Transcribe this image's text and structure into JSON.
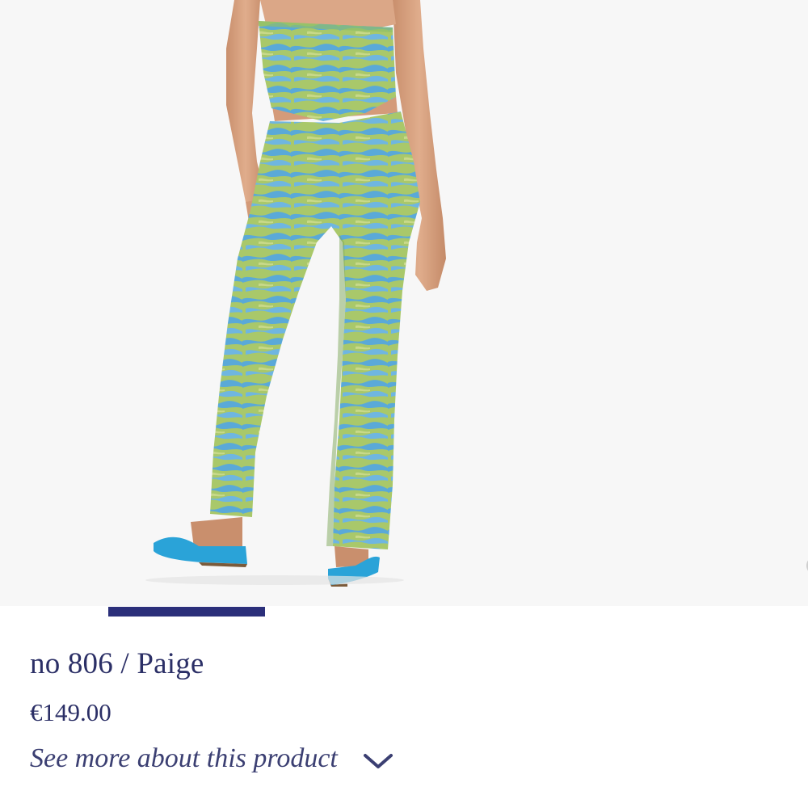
{
  "product": {
    "title": "no 806 / Paige",
    "price": "€149.00",
    "see_more_label": "See more about this product"
  },
  "gallery": {
    "current_slide": 1,
    "total_slides": 5,
    "progress_fraction": 0.2,
    "image_description_icon": "product-photo"
  },
  "icons": {
    "expand": "chevron-down-icon"
  },
  "colors": {
    "brand": "#2b2f66",
    "progress": "#2b2f7a",
    "gallery_bg": "#f7f7f7",
    "garment_green": "#a9c86a",
    "garment_blue": "#5aa9d8",
    "shoe_blue": "#2aa3d8"
  }
}
